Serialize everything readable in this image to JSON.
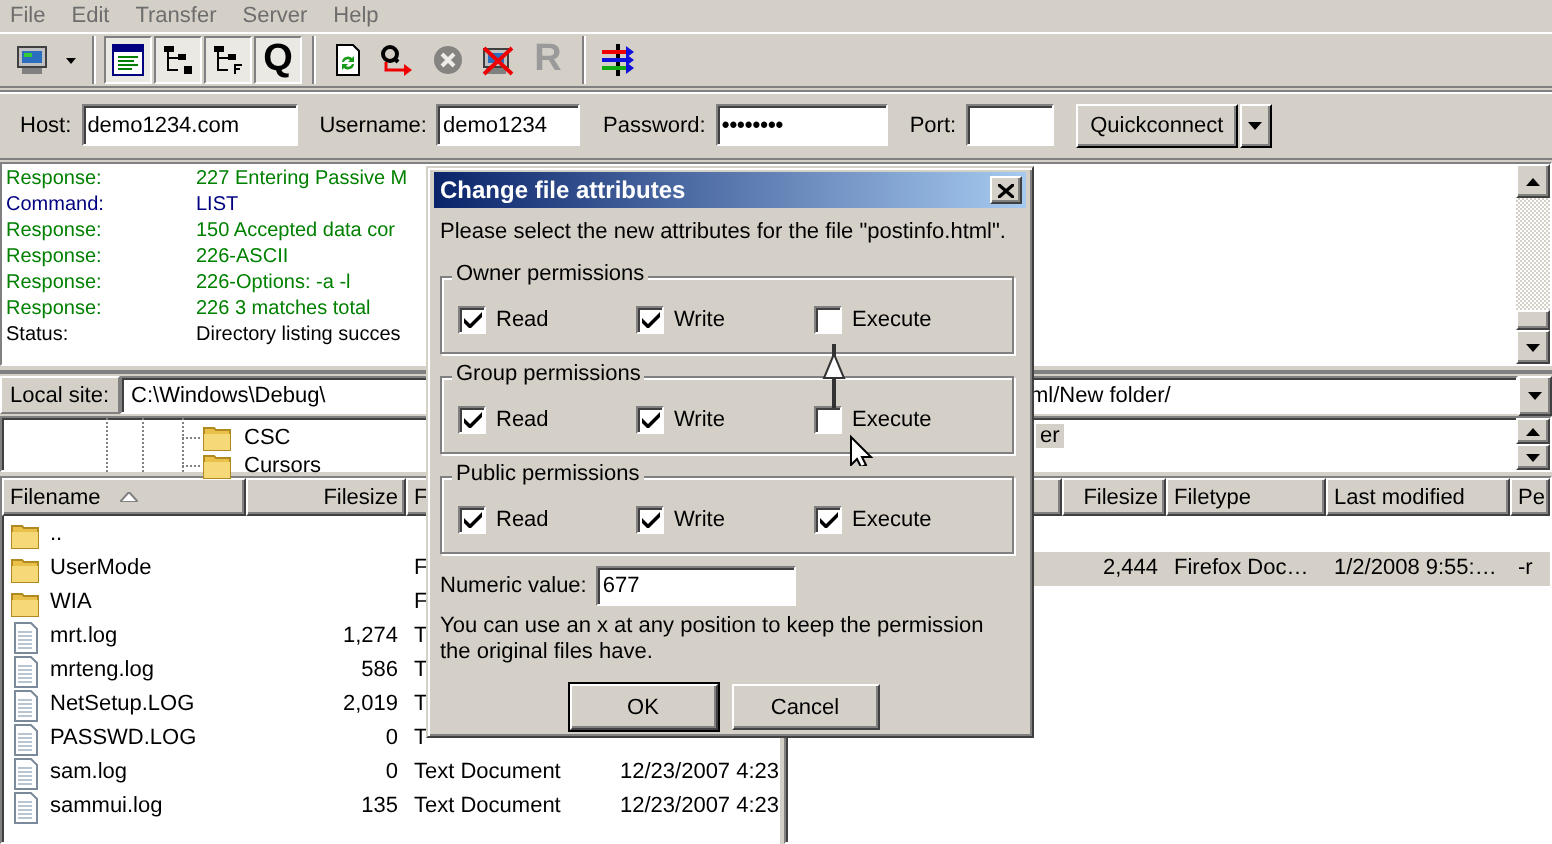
{
  "menu": [
    "File",
    "Edit",
    "Transfer",
    "Server",
    "Help"
  ],
  "toolbar": [
    [
      {
        "kind": "site-manager"
      },
      {
        "kind": "dropdown"
      }
    ],
    [
      {
        "kind": "message-log",
        "pressed": true
      },
      {
        "kind": "local-tree",
        "pressed": true
      },
      {
        "kind": "remote-tree",
        "pressed": true
      },
      {
        "kind": "queue",
        "glyph": "Q",
        "pressed": true
      }
    ],
    [
      {
        "kind": "refresh",
        "disabled": false
      },
      {
        "kind": "process-queue",
        "disabled": false
      },
      {
        "kind": "cancel",
        "disabled": true
      },
      {
        "kind": "disconnect",
        "disabled": false
      },
      {
        "kind": "reconnect",
        "glyph": "R",
        "disabled": true
      }
    ],
    [
      {
        "kind": "compare"
      }
    ]
  ],
  "quickconnect": {
    "host": {
      "label": "Host:",
      "value": "demo1234.com"
    },
    "username": {
      "label": "Username:",
      "value": "demo1234"
    },
    "password": {
      "label": "Password:",
      "value": "••••••••"
    },
    "port": {
      "label": "Port:"
    },
    "button": "Quickconnect"
  },
  "log": [
    {
      "kind": "response",
      "label": "Response:",
      "message": "227 Entering Passive M"
    },
    {
      "kind": "command",
      "label": "Command:",
      "message": "LIST"
    },
    {
      "kind": "response",
      "label": "Response:",
      "message": "150 Accepted data cor"
    },
    {
      "kind": "response",
      "label": "Response:",
      "message": "226-ASCII"
    },
    {
      "kind": "response",
      "label": "Response:",
      "message": "226-Options: -a -l"
    },
    {
      "kind": "response",
      "label": "Response:",
      "message": "226 3 matches total"
    },
    {
      "kind": "status",
      "label": "Status:",
      "message": "Directory listing succes"
    }
  ],
  "local": {
    "site_label": "Local site:",
    "path": "C:\\Windows\\Debug\\",
    "tree": [
      {
        "label": "CSC"
      },
      {
        "label": "Cursors"
      }
    ],
    "columns": [
      {
        "label": "Filename",
        "sorted": true
      },
      {
        "label": "Filesize"
      },
      {
        "label": "F"
      }
    ],
    "rows": [
      {
        "kind": "folder",
        "name": "..",
        "selected": false
      },
      {
        "kind": "folder",
        "name": "UserMode",
        "type": "F",
        "selected": false
      },
      {
        "kind": "folder",
        "name": "WIA",
        "type": "F",
        "selected": false
      },
      {
        "kind": "file",
        "name": "mrt.log",
        "size": "1,274",
        "type": "T",
        "selected": false
      },
      {
        "kind": "file",
        "name": "mrteng.log",
        "size": "586",
        "type": "T",
        "selected": false
      },
      {
        "kind": "file",
        "name": "NetSetup.LOG",
        "size": "2,019",
        "type": "T",
        "selected": false
      },
      {
        "kind": "file",
        "name": "PASSWD.LOG",
        "size": "0",
        "type": "T",
        "selected": false
      },
      {
        "kind": "file",
        "name": "sam.log",
        "size": "0",
        "type": "Text Document",
        "modified": "12/23/2007 4:23",
        "selected": false
      },
      {
        "kind": "file",
        "name": "sammui.log",
        "size": "135",
        "type": "Text Document",
        "modified": "12/23/2007 4:23",
        "selected": false
      }
    ]
  },
  "remote": {
    "path": "ml/New folder/",
    "tree": [
      {
        "label": "er",
        "selected": true
      }
    ],
    "columns": [
      {
        "label": "Filesize"
      },
      {
        "label": "Filetype"
      },
      {
        "label": "Last modified"
      },
      {
        "label": "Pe"
      }
    ],
    "rows": [
      {
        "size": "2,444",
        "type": "Firefox Doc…",
        "modified": "1/2/2008 9:55:…",
        "permissions": "-r",
        "selected": true
      }
    ]
  },
  "dialog": {
    "title": "Change file attributes",
    "message": "Please select the new attributes for the file \"postinfo.html\".",
    "groups": [
      {
        "title": "Owner permissions",
        "permissions": [
          {
            "label": "Read",
            "checked": true
          },
          {
            "label": "Write",
            "checked": true
          },
          {
            "label": "Execute",
            "checked": false
          }
        ]
      },
      {
        "title": "Group permissions",
        "permissions": [
          {
            "label": "Read",
            "checked": true
          },
          {
            "label": "Write",
            "checked": true
          },
          {
            "label": "Execute",
            "checked": false
          }
        ]
      },
      {
        "title": "Public permissions",
        "permissions": [
          {
            "label": "Read",
            "checked": true
          },
          {
            "label": "Write",
            "checked": true
          },
          {
            "label": "Execute",
            "checked": true
          }
        ]
      }
    ],
    "numeric": {
      "label": "Numeric value:",
      "value": "677"
    },
    "note": "You can use an x at any position to keep the permission the original files have.",
    "buttons": [
      {
        "label": "OK",
        "default": true
      },
      {
        "label": "Cancel",
        "default": false
      }
    ]
  }
}
